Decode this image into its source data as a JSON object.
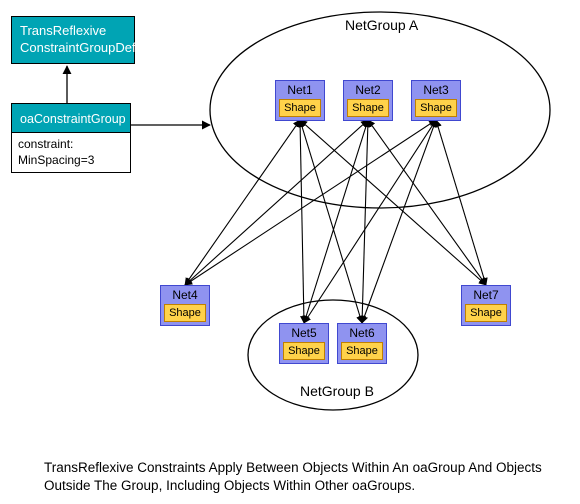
{
  "boxes": {
    "trans_def": {
      "l1": "TransReflexive",
      "l2": "ConstraintGroupDef"
    },
    "oa_cg": {
      "title": "oaConstraintGroup",
      "constraint_l1": "constraint:",
      "constraint_l2": "MinSpacing=3"
    }
  },
  "netgroup_a": {
    "label": "NetGroup A"
  },
  "netgroup_b": {
    "label": "NetGroup B"
  },
  "nets": {
    "n1": {
      "name": "Net1",
      "shape": "Shape"
    },
    "n2": {
      "name": "Net2",
      "shape": "Shape"
    },
    "n3": {
      "name": "Net3",
      "shape": "Shape"
    },
    "n4": {
      "name": "Net4",
      "shape": "Shape"
    },
    "n5": {
      "name": "Net5",
      "shape": "Shape"
    },
    "n6": {
      "name": "Net6",
      "shape": "Shape"
    },
    "n7": {
      "name": "Net7",
      "shape": "Shape"
    }
  },
  "caption": {
    "l1": "TransReflexive Constraints Apply Between Objects Within An oaGroup And Objects",
    "l2": "Outside The Group, Including Objects Within Other oaGroups."
  }
}
